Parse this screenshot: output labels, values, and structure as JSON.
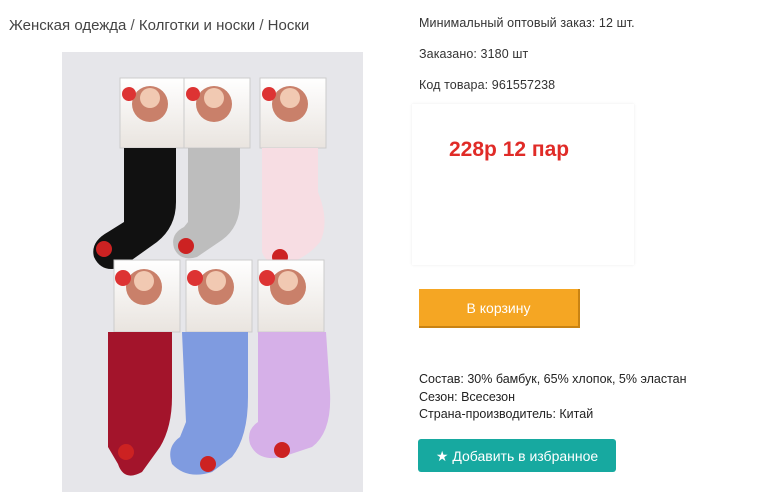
{
  "breadcrumb": {
    "items": [
      "Женская одежда",
      "Колготки и носки",
      "Носки"
    ],
    "separator": " / "
  },
  "product": {
    "min_order": "Минимальный оптовый заказ: 12 шт.",
    "ordered": "Заказано: 3180 шт",
    "code": "Код товара: 961557238",
    "price_note": "228р 12 пар"
  },
  "actions": {
    "cart_label": "В корзину",
    "favorite_label": "Добавить в избранное",
    "favorite_icon": "star-icon"
  },
  "specs": {
    "composition": "Состав: 30% бамбук, 65% хлопок, 5% эластан",
    "season": "Сезон: Всесезон",
    "country": "Страна-производитель: Китай"
  },
  "colors": {
    "price": "#e02b27",
    "cart_button": "#f5a623",
    "favorite_button": "#17a9a0",
    "photo_background": "#e6e6ea",
    "sock_colors": [
      "#111111",
      "#bdbdbd",
      "#f7dde3",
      "#a3142b",
      "#7f9be0",
      "#d6b0e8"
    ]
  }
}
